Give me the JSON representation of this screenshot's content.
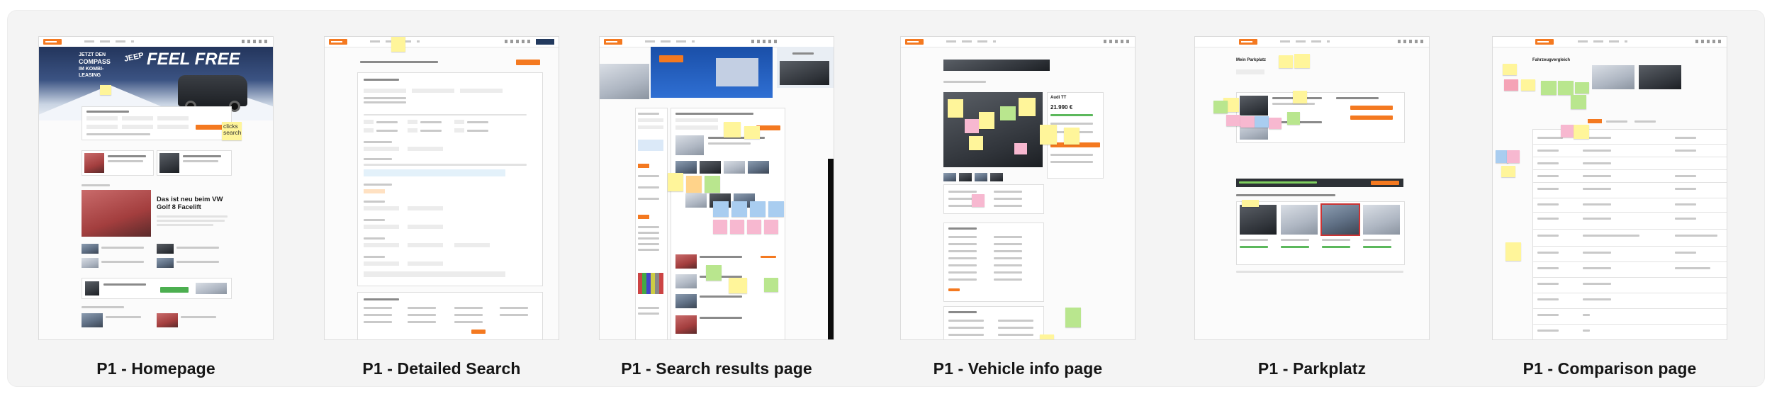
{
  "captions": {
    "homepage": "P1 - Homepage",
    "detailed_search": "P1 - Detailed Search",
    "search_results": "P1 - Search results page",
    "vehicle_info": "P1 - Vehicle info page",
    "parkplatz": "P1 - Parkplatz",
    "comparison": "P1 - Comparison page"
  },
  "colors": {
    "brand_orange": "#f47920",
    "sticky_yellow": "#fff59a",
    "sticky_green": "#b9e68e",
    "sticky_pink": "#f5a3b6",
    "sticky_blue": "#a9cdf0",
    "board_background": "#f4f4f4"
  },
  "homepage": {
    "hero_line1": "JETZT DEN",
    "hero_line2": "COMPASS",
    "hero_line3": "IM KOMBI-",
    "hero_line4": "LEASING",
    "hero_big1": "FEEL FREE",
    "hero_big2": "JEEP",
    "sticky_clicks_search": "clicks search",
    "article_title": "Das ist neu beim VW Golf 8 Facelift"
  },
  "vehicle_info": {
    "title": "Audi TT",
    "price": "21.990 €"
  },
  "parkplatz": {
    "title": "Mein Parkplatz"
  },
  "comparison": {
    "title": "Fahrzeugvergleich"
  }
}
